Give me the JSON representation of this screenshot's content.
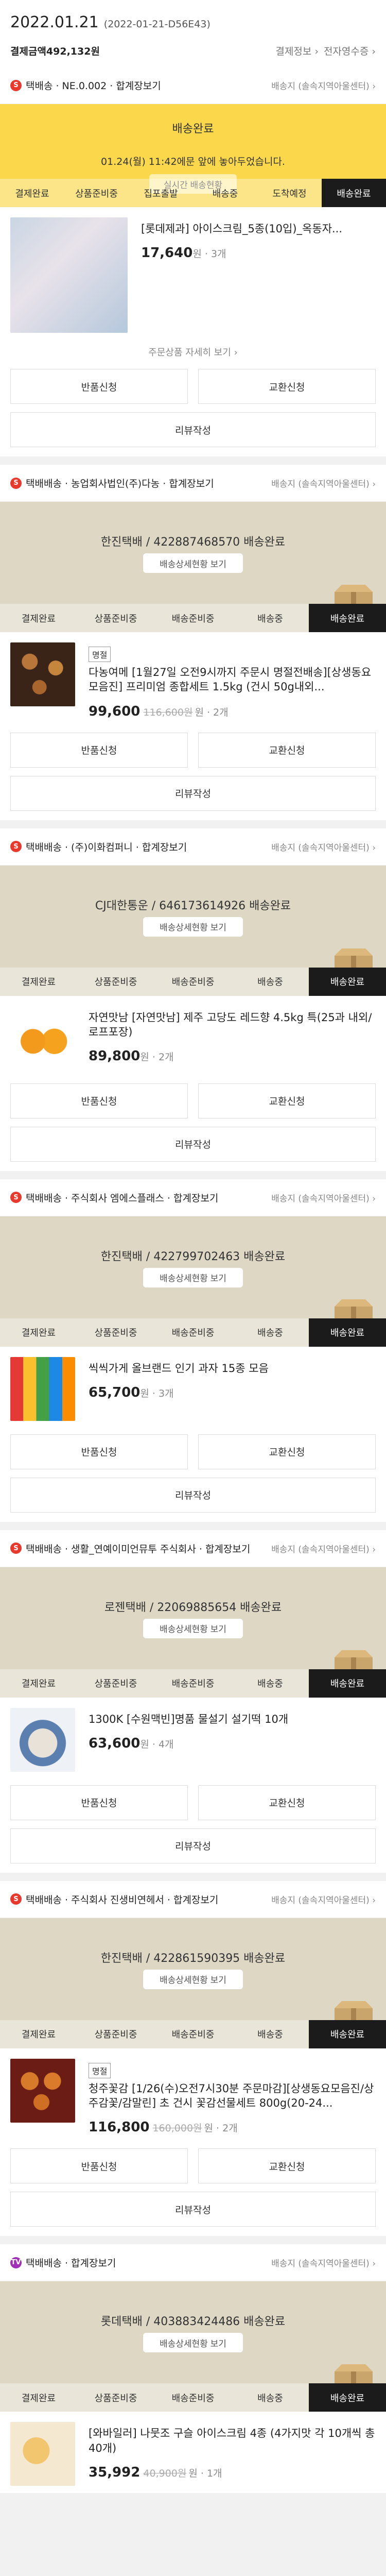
{
  "order": {
    "date": "2022.01.21",
    "order_no": "(2022-01-21-D56E43)",
    "amount_label": "결제금액492,132원",
    "cancel_link": "결제정보 ›",
    "receipt_link": "전자영수증 ›"
  },
  "colors": {
    "tab_active": "#1b1b1b",
    "badge": "#e8392c",
    "banner_yellow": "#fbd74b",
    "banner_beige": "#ddd7c4"
  },
  "groups": [
    {
      "seller": "택배송 · NE.0.002 · 합계장보기",
      "right": "배송지 (솔속지역아울센터) ›",
      "badge": "S",
      "banner": "yellow",
      "caption": "배송완료",
      "sub": "01.24(월) 11:42에문 앞에 놓아두었습니다.",
      "track_btn": "실시간 배송현황",
      "tabs": [
        "결제완료",
        "상품준비중",
        "집포출발",
        "배송중",
        "도착예정",
        "배송완료"
      ],
      "product": {
        "tag": "",
        "name": "[롯데제과] 아이스크림_5종(10입)_옥동자...",
        "price": "17,640",
        "unit": "원 · 3개",
        "orig": ""
      },
      "detail_link": "주문상품 자세히 보기 ›",
      "large": true,
      "buttons": [
        "반품신청",
        "교환신청",
        "리뷰작성"
      ]
    },
    {
      "seller": "택배배송 · 농업회사법인(주)다농 · 합계장보기",
      "right": "배송지 (솔속지역아울센터) ›",
      "badge": "S",
      "banner": "beige",
      "caption": "한진택배 / 422887468570 배송완료",
      "track_btn": "배송상세현황 보기",
      "tabs": [
        "결제완료",
        "상품준비중",
        "배송준비중",
        "배송중",
        "배송완료"
      ],
      "product": {
        "tag": "명절",
        "name": "다농여메 [1월27일 오전9시까지 주문시 명절전배송][상생동요모음진] 프리미엄 종합세트 1.5kg (건시 50g내외...",
        "price": "99,600",
        "unit": "원 · 2개",
        "orig": "116,600원"
      },
      "large": false,
      "buttons": [
        "반품신청",
        "교환신청",
        "리뷰작성"
      ]
    },
    {
      "seller": "택배배송 · (주)이화컴퍼니 · 합계장보기",
      "right": "배송지 (솔속지역아울센터) ›",
      "badge": "S",
      "banner": "beige",
      "caption": "CJ대한통운 / 646173614926 배송완료",
      "track_btn": "배송상세현황 보기",
      "tabs": [
        "결제완료",
        "상품준비중",
        "배송준비중",
        "배송중",
        "배송완료"
      ],
      "product": {
        "tag": "",
        "name": "자연맛남 [자연맛남] 제주 고당도 레드향 4.5kg 특(25과 내외/로프포장)",
        "price": "89,800",
        "unit": "원 · 2개",
        "orig": ""
      },
      "large": false,
      "buttons": [
        "반품신청",
        "교환신청",
        "리뷰작성"
      ]
    },
    {
      "seller": "택배배송 · 주식회사 엠에스플래스 · 합계장보기",
      "right": "배송지 (솔속지역아울센터) ›",
      "badge": "S",
      "banner": "beige",
      "caption": "한진택배 / 422799702463 배송완료",
      "track_btn": "배송상세현황 보기",
      "tabs": [
        "결제완료",
        "상품준비중",
        "배송준비중",
        "배송중",
        "배송완료"
      ],
      "product": {
        "tag": "",
        "name": "씩씩가게 올브랜드 인기 과자 15종 모음",
        "price": "65,700",
        "unit": "원 · 3개",
        "orig": ""
      },
      "large": false,
      "buttons": [
        "반품신청",
        "교환신청",
        "리뷰작성"
      ]
    },
    {
      "seller": "택배배송 · 생활_연예이미언뮤투 주식회사 · 합계장보기",
      "right": "배송지 (솔속지역아울센터) ›",
      "badge": "S",
      "banner": "beige",
      "caption": "로젠택배 / 22069885654 배송완료",
      "track_btn": "배송상세현황 보기",
      "tabs": [
        "결제완료",
        "상품준비중",
        "배송준비중",
        "배송중",
        "배송완료"
      ],
      "product": {
        "tag": "",
        "name": "1300K [수원맥빈]명품 물설기 설기떡 10개",
        "price": "63,600",
        "unit": "원 · 4개",
        "orig": ""
      },
      "large": false,
      "buttons": [
        "반품신청",
        "교환신청",
        "리뷰작성"
      ]
    },
    {
      "seller": "택배배송 · 주식회사 진생비연헤서 · 합계장보기",
      "right": "배송지 (솔속지역아울센터) ›",
      "badge": "S",
      "banner": "beige",
      "caption": "한진택배 / 422861590395 배송완료",
      "track_btn": "배송상세현황 보기",
      "tabs": [
        "결제완료",
        "상품준비중",
        "배송준비중",
        "배송중",
        "배송완료"
      ],
      "product": {
        "tag": "명절",
        "name": "청주꽃감 [1/26(수)오전7시30분 주문마감][상생동요모음진/상주감꽃/감말린] 초 건시 꽃감선물세트 800g(20-24...",
        "price": "116,800",
        "unit": "원 · 2개",
        "orig": "160,000원"
      },
      "large": false,
      "buttons": [
        "반품신청",
        "교환신청",
        "리뷰작성"
      ]
    },
    {
      "seller": "택배배송 · 합계장보기",
      "right": "배송지 (솔속지역아울센터) ›",
      "badge": "TV",
      "banner": "beige",
      "caption": "롯데택배 / 403883424486 배송완료",
      "track_btn": "배송상세현황 보기",
      "tabs": [
        "결제완료",
        "상품준비중",
        "배송준비중",
        "배송중",
        "배송완료"
      ],
      "product": {
        "tag": "",
        "name": "[와바일러] 나뭇조 구슬 아이스크림 4종 (4가지맛 각 10개씩 총 40개)",
        "price": "35,992",
        "unit": "원 · 1개",
        "orig": "40,900원"
      },
      "large": false,
      "buttons": []
    }
  ]
}
